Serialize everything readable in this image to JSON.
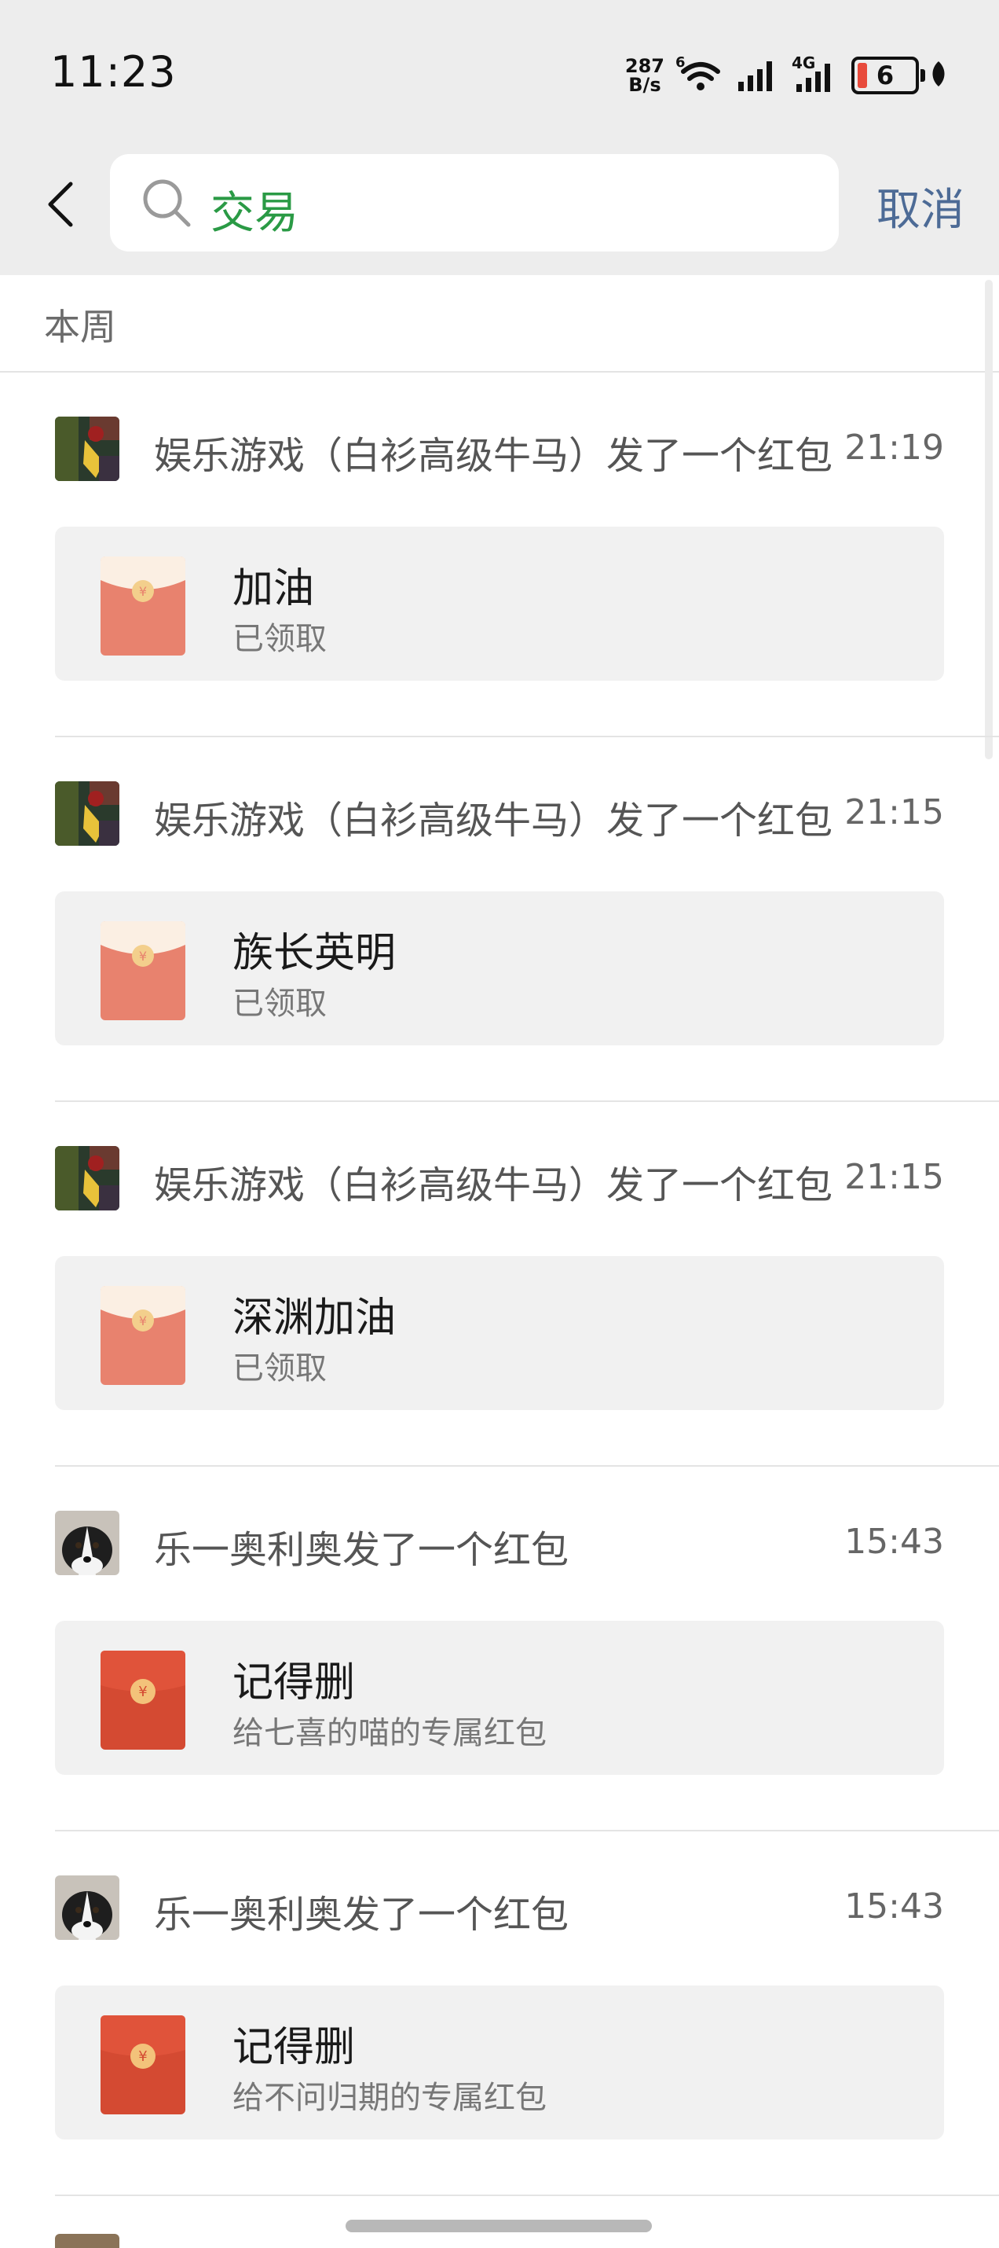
{
  "status_bar": {
    "time": "11:23",
    "net_speed_value": "287",
    "net_speed_unit": "B/s",
    "wifi_badge": "6",
    "network_type": "4G",
    "battery_level": "6"
  },
  "header": {
    "search_query": "交易",
    "cancel_label": "取消"
  },
  "section": {
    "label": "本周"
  },
  "results": [
    {
      "sender": "娱乐游戏（白衫高级牛马）发了一个红包",
      "time": "21:19",
      "title": "加油",
      "subtitle": "已领取",
      "claimed": true,
      "avatar": "game-avatar"
    },
    {
      "sender": "娱乐游戏（白衫高级牛马）发了一个红包",
      "time": "21:15",
      "title": "族长英明",
      "subtitle": "已领取",
      "claimed": true,
      "avatar": "game-avatar"
    },
    {
      "sender": "娱乐游戏（白衫高级牛马）发了一个红包",
      "time": "21:15",
      "title": "深渊加油",
      "subtitle": "已领取",
      "claimed": true,
      "avatar": "game-avatar"
    },
    {
      "sender": "乐一奥利奥发了一个红包",
      "time": "15:43",
      "title": "记得删",
      "subtitle": "给七喜的喵的专属红包",
      "claimed": false,
      "avatar": "dog-avatar"
    },
    {
      "sender": "乐一奥利奥发了一个红包",
      "time": "15:43",
      "title": "记得删",
      "subtitle": "给不问归期的专属红包",
      "claimed": false,
      "avatar": "dog-avatar"
    }
  ],
  "colors": {
    "search_text": "#2a9a45",
    "cancel": "#4d6b96",
    "envelope_claimed": "#e8826e",
    "envelope_unclaimed": "#d44a32",
    "background_bar": "#ededed"
  }
}
